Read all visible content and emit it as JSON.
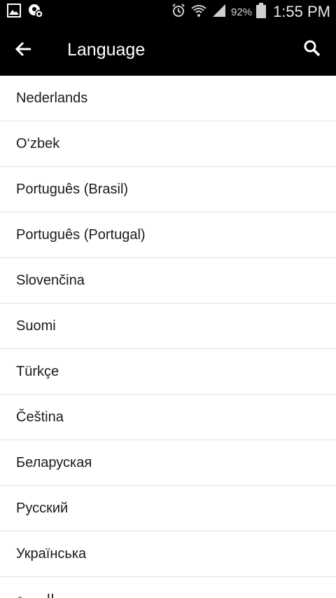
{
  "status_bar": {
    "icons_left": [
      "gallery-icon",
      "app-notification-icon"
    ],
    "icons_right": [
      "alarm-icon",
      "wifi-icon",
      "signal-icon",
      "battery-icon"
    ],
    "battery_percent": "92%",
    "time": "1:55 PM"
  },
  "app_bar": {
    "title": "Language",
    "back_icon": "arrow-left-icon",
    "search_icon": "search-icon",
    "background": "#000000"
  },
  "languages": [
    {
      "label": "Nederlands"
    },
    {
      "label": "O‘zbek"
    },
    {
      "label": "Português (Brasil)"
    },
    {
      "label": "Português (Portugal)"
    },
    {
      "label": "Slovenčina"
    },
    {
      "label": "Suomi"
    },
    {
      "label": "Türkçe"
    },
    {
      "label": "Čeština"
    },
    {
      "label": "Беларуская"
    },
    {
      "label": "Русский"
    },
    {
      "label": "Українська"
    },
    {
      "label": "العربية"
    }
  ]
}
